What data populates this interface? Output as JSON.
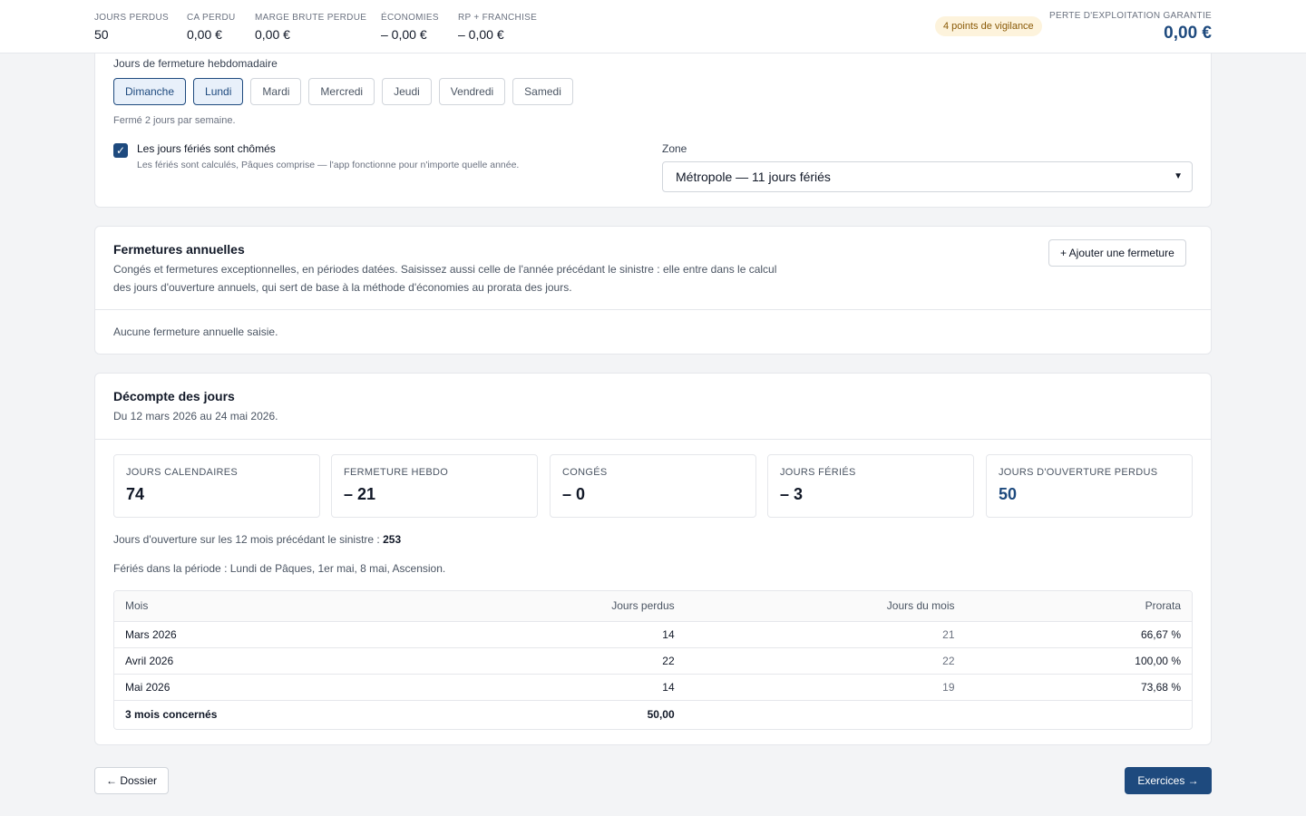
{
  "topbar": {
    "metrics": [
      {
        "label": "JOURS PERDUS",
        "value": "50"
      },
      {
        "label": "CA PERDU",
        "value": "0,00 €"
      },
      {
        "label": "MARGE BRUTE PERDUE",
        "value": "0,00 €"
      },
      {
        "label": "ÉCONOMIES",
        "value": "– 0,00 €"
      },
      {
        "label": "RP + FRANCHISE",
        "value": "– 0,00 €"
      }
    ],
    "vigilance_badge": "4 points de vigilance",
    "perte_label": "PERTE D'EXPLOITATION GARANTIE",
    "perte_value": "0,00 €"
  },
  "weekly": {
    "title": "Jours de fermeture hebdomadaire",
    "days": [
      {
        "label": "Dimanche",
        "active": true
      },
      {
        "label": "Lundi",
        "active": true
      },
      {
        "label": "Mardi",
        "active": false
      },
      {
        "label": "Mercredi",
        "active": false
      },
      {
        "label": "Jeudi",
        "active": false
      },
      {
        "label": "Vendredi",
        "active": false
      },
      {
        "label": "Samedi",
        "active": false
      }
    ],
    "closed_hint": "Fermé 2 jours par semaine.",
    "holidays_checkbox_label": "Les jours fériés sont chômés",
    "holidays_hint": "Les fériés sont calculés, Pâques comprise — l'app fonctionne pour n'importe quelle année.",
    "zone_label": "Zone",
    "zone_value": "Métropole — 11 jours fériés"
  },
  "annual": {
    "title": "Fermetures annuelles",
    "description_line1": "Congés et fermetures exceptionnelles, en périodes datées. Saisissez aussi celle de l'année précédant le sinistre : elle entre dans le calcul",
    "description_line2": "des jours d'ouverture annuels, qui sert de base à la méthode d'économies au prorata des jours.",
    "add_button": "+ Ajouter une fermeture",
    "empty_text": "Aucune fermeture annuelle saisie."
  },
  "decompte": {
    "title": "Décompte des jours",
    "period": "Du 12 mars 2026 au 24 mai 2026.",
    "stats": [
      {
        "label": "JOURS CALENDAIRES",
        "value": "74"
      },
      {
        "label": "FERMETURE HEBDO",
        "value": "– 21"
      },
      {
        "label": "CONGÉS",
        "value": "– 0"
      },
      {
        "label": "JOURS FÉRIÉS",
        "value": "– 3"
      },
      {
        "label": "JOURS D'OUVERTURE PERDUS",
        "value": "50"
      }
    ],
    "ouverture_text": "Jours d'ouverture sur les 12 mois précédant le sinistre : ",
    "ouverture_value": "253",
    "feries_text": "Fériés dans la période : Lundi de Pâques, 1er mai, 8 mai, Ascension.",
    "table": {
      "headers": [
        "Mois",
        "Jours perdus",
        "Jours du mois",
        "Prorata"
      ],
      "rows": [
        [
          "Mars 2026",
          "14",
          "21",
          "66,67 %"
        ],
        [
          "Avril 2026",
          "22",
          "22",
          "100,00 %"
        ],
        [
          "Mai 2026",
          "14",
          "19",
          "73,68 %"
        ]
      ],
      "total_label": "3 mois concernés",
      "total_value": "50,00"
    }
  },
  "nav": {
    "back": "← Dossier",
    "next": "Exercices →"
  }
}
